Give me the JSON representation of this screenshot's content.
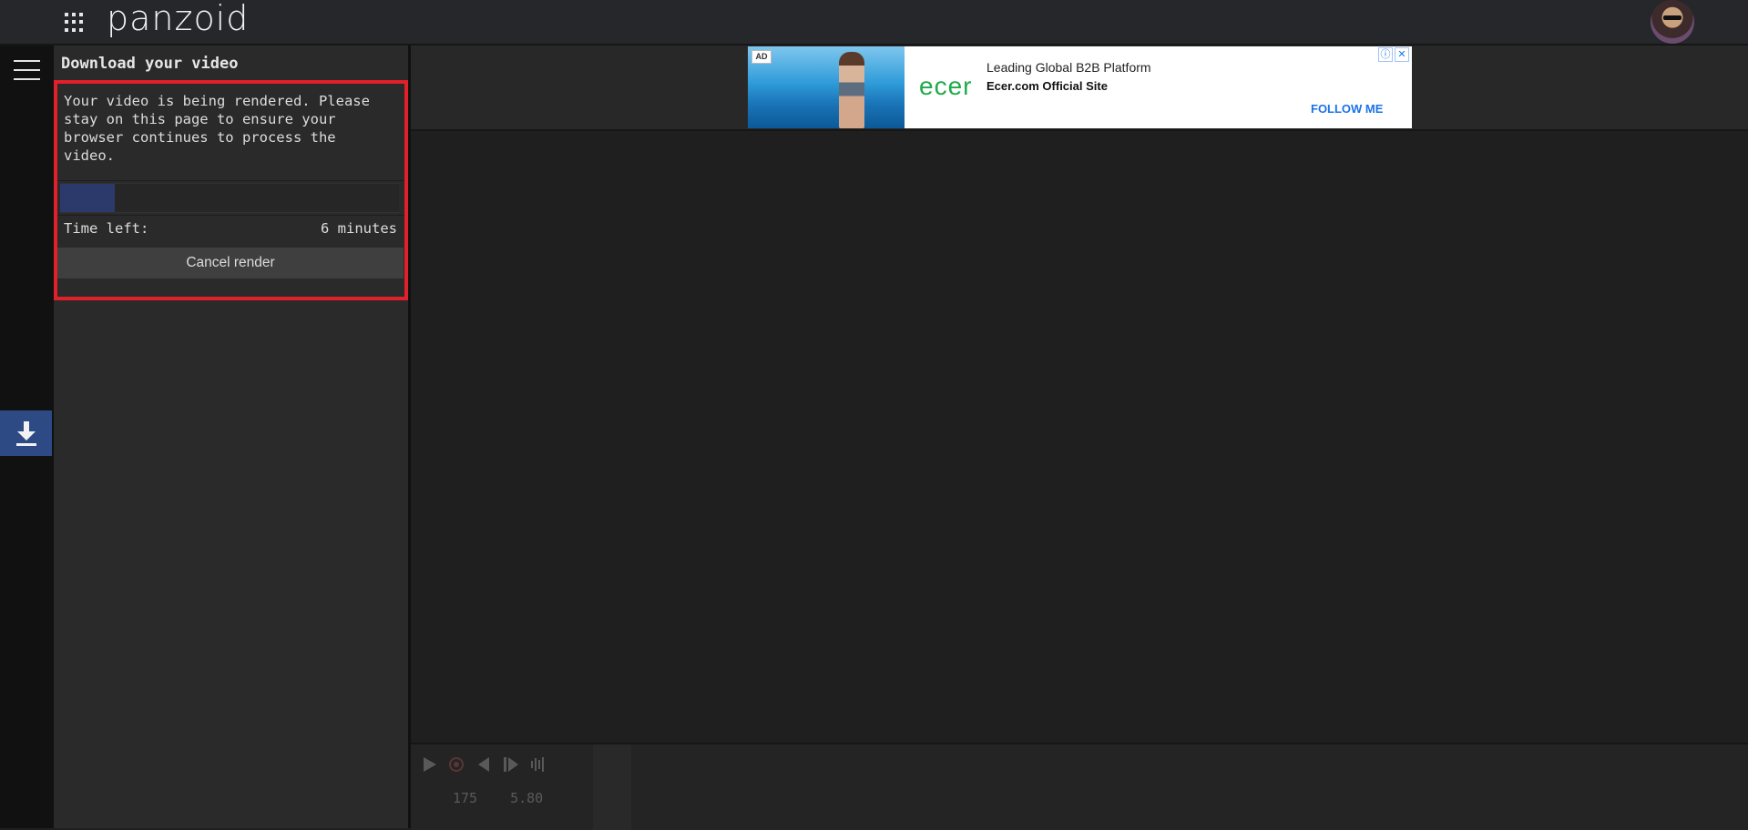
{
  "header": {
    "logo": "panzoid",
    "apps_icon": "apps-grid-icon",
    "avatar": "user-avatar"
  },
  "rail": {
    "menu_icon": "hamburger-icon",
    "download_icon": "download-icon"
  },
  "panel": {
    "title": "Download your video",
    "render_message": "Your video is being rendered. Please stay on this page to ensure your browser continues to process the video.",
    "progress_fraction": 0.16,
    "time_left_label": "Time left:",
    "time_left_value": "6 minutes",
    "cancel_label": "Cancel render"
  },
  "ad": {
    "badge": "AD",
    "brand": "ecer",
    "headline": "Leading Global B2B Platform",
    "site": "Ecer.com Official Site",
    "cta": "FOLLOW ME"
  },
  "timeline": {
    "readout_1": "175",
    "readout_2": "5.80"
  },
  "colors": {
    "accent_blue": "#2d4a85",
    "highlight_red": "#e0202a",
    "progress_fill": "#2c3a6b"
  }
}
